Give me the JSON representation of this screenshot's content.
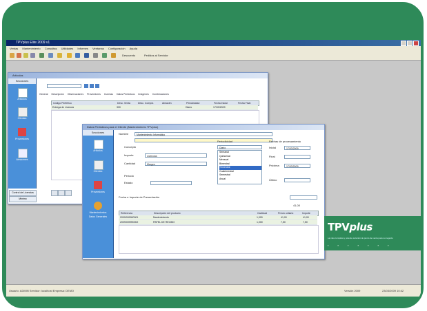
{
  "app": {
    "title": "TPVplus Elite 2009 v1"
  },
  "menu": [
    "Ventas",
    "Mantenimiento",
    "Consultas",
    "Utilidades",
    "Informes",
    "Ventanas",
    "Configuración",
    "Ayuda"
  ],
  "toolbar": {
    "label_a": "Descuento",
    "label_b": "Pedidos al Servidor"
  },
  "articulos_window": {
    "title": "Artículos",
    "sidebar_header": "Secciones",
    "sidebar_items": [
      "Articulos",
      "Clientes",
      "Proveedores",
      "Almacenes"
    ],
    "tabs": [
      "General",
      "Descripción",
      "Observaciones",
      "Proveedores",
      "Cuentas",
      "Datos Periódicos",
      "Imágenes",
      "Combinaciones"
    ],
    "columns": [
      "Código Periférico",
      "Desc. Venta",
      "Desc. Compra",
      "Almacén",
      "Periodicidad",
      "Fecha Inicial",
      "Fecha Final"
    ],
    "row": [
      "Entrega de Licencia",
      "300",
      "",
      "",
      "Diario",
      "17/03/2009",
      ""
    ],
    "bottom_left": "Control de Licencias",
    "bottom_left2": "Mínimo"
  },
  "periodicos_window": {
    "title": "Datos Periódicos para el Cliente (Mantenimiento TPVplus)",
    "sidebar_header": "Secciones",
    "sidebar_items": [
      "Artículos",
      "Clientes",
      "Proveedores",
      "Mantenimientos",
      "Datos Generales"
    ],
    "name_label": "Nombre",
    "name_value": "Mantenimiento Informático",
    "periodicity_label": "Periodicidad",
    "period_value": "Diario",
    "period_options": [
      "Semanal",
      "Quincenal",
      "Mensual",
      "Bimestral",
      "Trimestral",
      "Cuatrimestral",
      "Semestral",
      "Anual"
    ],
    "dates_label": "Fechas de procesamiento",
    "date_labels": [
      "Inicial",
      "Final",
      "Próxima",
      "Último"
    ],
    "date_values": [
      "17/03/2009",
      "",
      "17/03/2009",
      ""
    ],
    "fields": [
      "Concepto",
      "Importe",
      "Cantidad",
      "Periodo",
      "Estado"
    ],
    "values": [
      "Licencias",
      "",
      "Margen",
      ""
    ],
    "grid_label": "Fecha e Importe de Presentación",
    "columns": [
      "Referencia",
      "Descripción del producto",
      "Cantidad",
      "Precio unitario",
      "Importe"
    ],
    "rows": [
      [
        "2009/009990001",
        "Mantenimiento",
        "1,000",
        "41,00",
        "41,00"
      ],
      [
        "2009/009990002",
        "PAPEL DE RECIBO",
        "1,000",
        "7,50",
        "7,50"
      ]
    ],
    "footer_total": "41,00"
  },
  "brand": {
    "name_main": "TPV",
    "name_italic": "plus",
    "tagline": "La más completa y potente solución de punto de venta para su negocio"
  },
  "statusbar": {
    "left": "Usuario: ADMIN  Servidor: localhost  Empresa: DEMO",
    "mid": "Versión 2009",
    "right": "23/03/2009 10:42"
  }
}
